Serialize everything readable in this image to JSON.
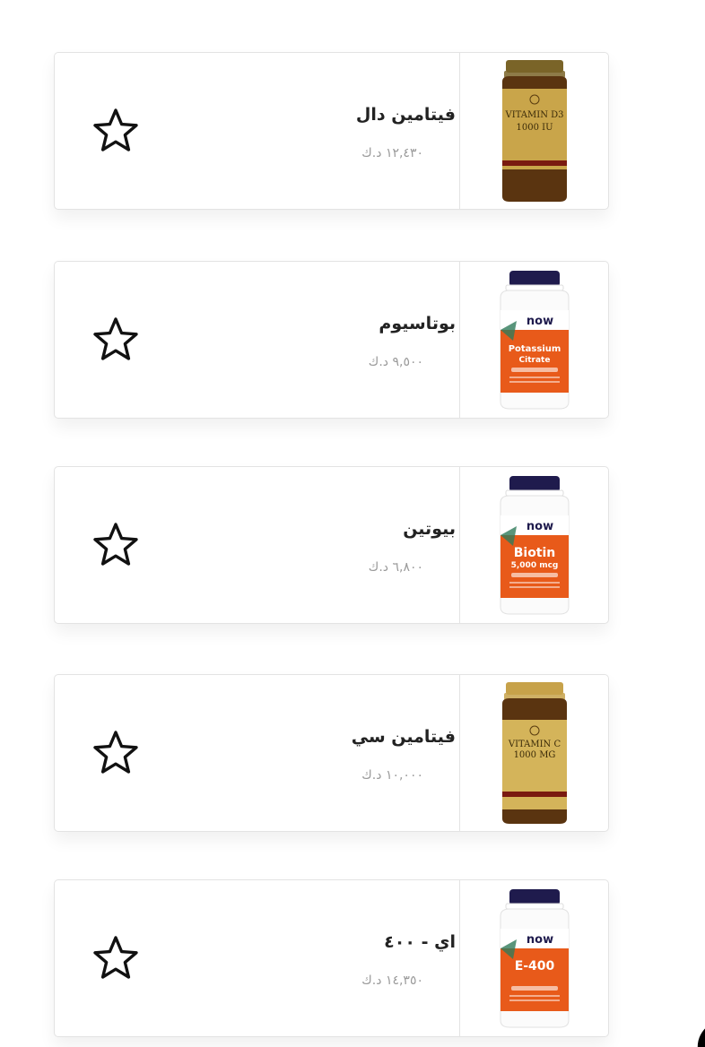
{
  "products": [
    {
      "name": "فيتامين دال",
      "price": "١٢,٤٣٠ د.ك",
      "bottle": {
        "style": "amber",
        "cap": "#7a6428",
        "body": "#5a3410",
        "label_bg": "#c9a54a",
        "line1": "VITAMIN D3",
        "line2": "1000 IU"
      }
    },
    {
      "name": "بوتاسيوم",
      "price": "٩,٥٠٠ د.ك",
      "bottle": {
        "style": "white",
        "cap": "#1f1b4d",
        "label_bg": "#e85a1a",
        "brand": "now",
        "line1": "Potassium",
        "line2": "Citrate"
      }
    },
    {
      "name": "بيوتين",
      "price": "٦,٨٠٠ د.ك",
      "bottle": {
        "style": "white",
        "cap": "#1f1b4d",
        "label_bg": "#e85a1a",
        "brand": "now",
        "line1": "Biotin",
        "line2": "5,000 mcg"
      }
    },
    {
      "name": "فيتامين سي",
      "price": "١٠,٠٠٠ د.ك",
      "bottle": {
        "style": "amber",
        "cap": "#c7a24a",
        "body": "#5a3410",
        "label_bg": "#d4b45a",
        "line1": "VITAMIN C",
        "line2": "1000 MG"
      }
    },
    {
      "name": "اي - ٤٠٠",
      "price": "١٤,٣٥٠ د.ك",
      "bottle": {
        "style": "white",
        "cap": "#1f1b4d",
        "label_bg": "#e85a1a",
        "brand": "now",
        "line1": "E-400",
        "line2": ""
      }
    }
  ],
  "icons": {
    "favorite": "star-outline-icon"
  }
}
